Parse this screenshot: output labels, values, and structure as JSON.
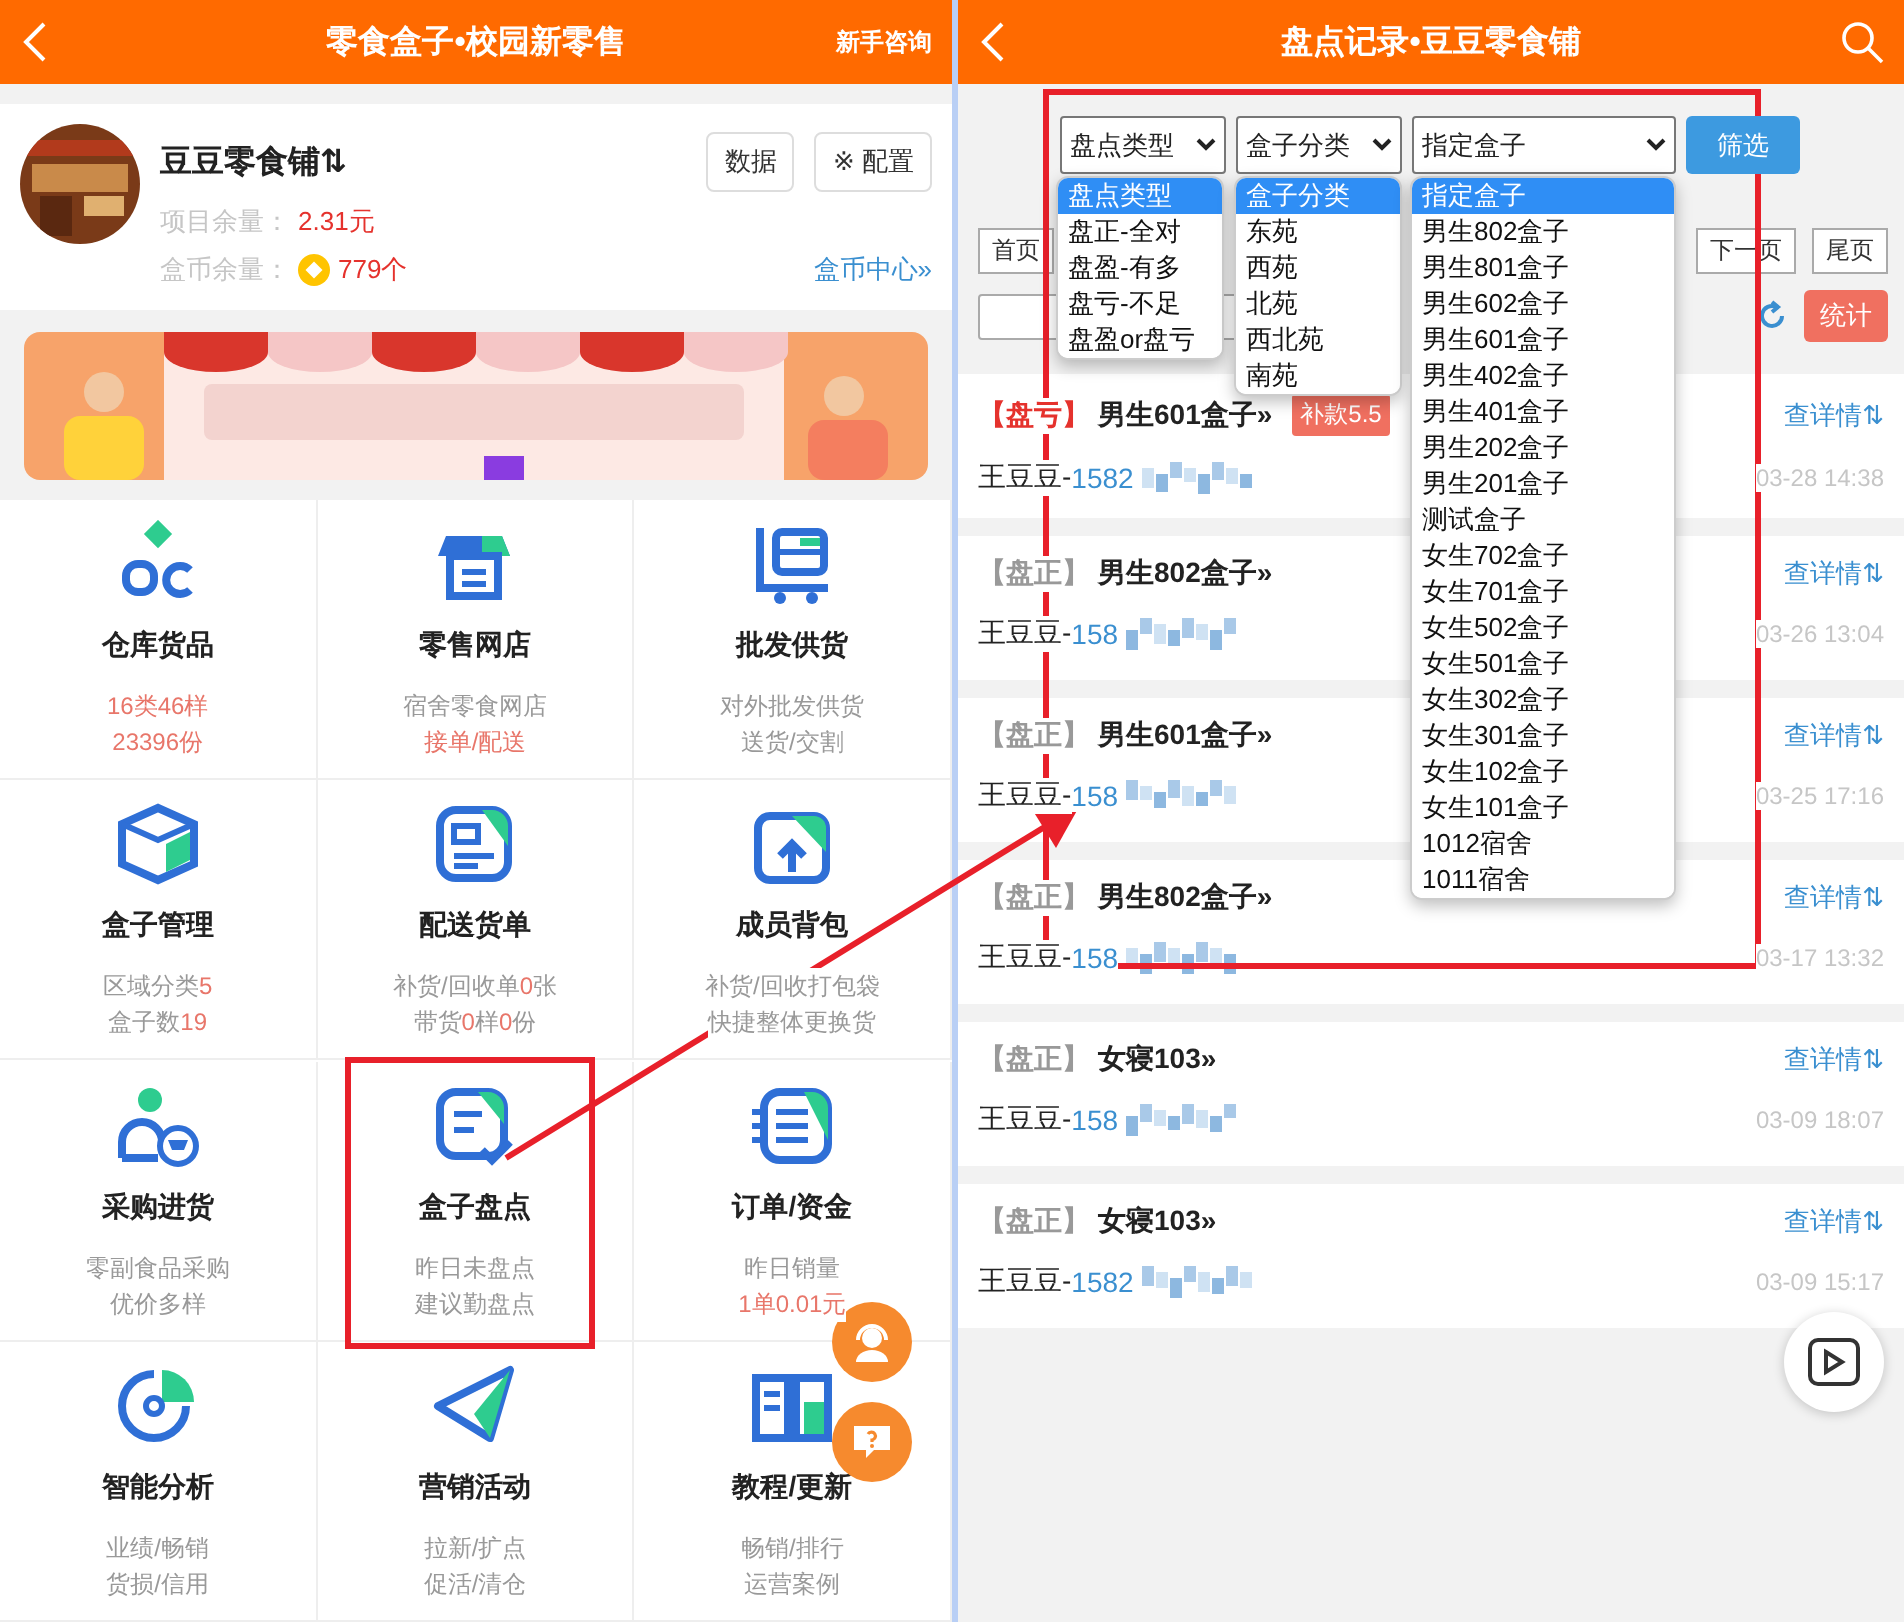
{
  "left": {
    "header": {
      "title": "零食盒子•校园新零售",
      "action": "新手咨询"
    },
    "store": {
      "name": "豆豆零食铺⇅",
      "buttons": [
        "数据",
        "※ 配置"
      ],
      "balance_label": "项目余量：",
      "balance_value": "2.31元",
      "coins_label": "盒币余量：",
      "coins_value": "779个",
      "link": "盒币中心»"
    },
    "tiles": [
      {
        "title": "仓库货品",
        "lines": [
          [
            {
              "text": "16类46样",
              "accent": true
            }
          ],
          [
            {
              "text": "23396份",
              "accent": true
            }
          ]
        ]
      },
      {
        "title": "零售网店",
        "lines": [
          [
            {
              "text": "宿舍零食网店",
              "accent": false
            }
          ],
          [
            {
              "text": "接单/配送",
              "accent": true
            }
          ]
        ]
      },
      {
        "title": "批发供货",
        "lines": [
          [
            {
              "text": "对外批发供货",
              "accent": false
            }
          ],
          [
            {
              "text": "送货/交割",
              "accent": false
            }
          ]
        ]
      },
      {
        "title": "盒子管理",
        "lines": [
          [
            {
              "text": "区域分类",
              "accent": false
            },
            {
              "text": "5",
              "accent": true
            }
          ],
          [
            {
              "text": "盒子数",
              "accent": false
            },
            {
              "text": "19",
              "accent": true
            }
          ]
        ]
      },
      {
        "title": "配送货单",
        "lines": [
          [
            {
              "text": "补货/回收单",
              "accent": false
            },
            {
              "text": "0",
              "accent": true
            },
            {
              "text": "张",
              "accent": false
            }
          ],
          [
            {
              "text": "带货",
              "accent": false
            },
            {
              "text": "0",
              "accent": true
            },
            {
              "text": "样",
              "accent": false
            },
            {
              "text": "0",
              "accent": true
            },
            {
              "text": "份",
              "accent": false
            }
          ]
        ]
      },
      {
        "title": "成员背包",
        "lines": [
          [
            {
              "text": "补货/回收打包袋",
              "accent": false
            }
          ],
          [
            {
              "text": "快捷整体更换货",
              "accent": false
            }
          ]
        ]
      },
      {
        "title": "采购进货",
        "lines": [
          [
            {
              "text": "零副食品采购",
              "accent": false
            }
          ],
          [
            {
              "text": "优价多样",
              "accent": false
            }
          ]
        ]
      },
      {
        "title": "盒子盘点",
        "lines": [
          [
            {
              "text": "昨日未盘点",
              "accent": false
            }
          ],
          [
            {
              "text": "建议勤盘点",
              "accent": false
            }
          ]
        ]
      },
      {
        "title": "订单/资金",
        "lines": [
          [
            {
              "text": "昨日销量",
              "accent": false
            }
          ],
          [
            {
              "text": "1单0.01元",
              "accent": true
            }
          ]
        ]
      },
      {
        "title": "智能分析",
        "lines": [
          [
            {
              "text": "业绩/畅销",
              "accent": false
            }
          ],
          [
            {
              "text": "货损/信用",
              "accent": false
            }
          ]
        ]
      },
      {
        "title": "营销活动",
        "lines": [
          [
            {
              "text": "拉新/扩点",
              "accent": false
            }
          ],
          [
            {
              "text": "促活/清仓",
              "accent": false
            }
          ]
        ]
      },
      {
        "title": "教程/更新",
        "lines": [
          [
            {
              "text": "畅销/排行",
              "accent": false
            }
          ],
          [
            {
              "text": "运营案例",
              "accent": false
            }
          ]
        ]
      }
    ]
  },
  "right": {
    "header": {
      "title": "盘点记录•豆豆零食铺"
    },
    "filters": [
      {
        "label": "盘点类型",
        "options": [
          {
            "label": "盘点类型",
            "selected": true
          },
          {
            "label": "盘正-全对",
            "selected": false
          },
          {
            "label": "盘盈-有多",
            "selected": false
          },
          {
            "label": "盘亏-不足",
            "selected": false
          },
          {
            "label": "盘盈or盘亏",
            "selected": false
          }
        ]
      },
      {
        "label": "盒子分类",
        "options": [
          {
            "label": "盒子分类",
            "selected": true
          },
          {
            "label": "东苑",
            "selected": false
          },
          {
            "label": "西苑",
            "selected": false
          },
          {
            "label": "北苑",
            "selected": false
          },
          {
            "label": "西北苑",
            "selected": false
          },
          {
            "label": "南苑",
            "selected": false
          }
        ]
      },
      {
        "label": "指定盒子",
        "options": [
          {
            "label": "指定盒子",
            "selected": true
          },
          {
            "label": "男生802盒子",
            "selected": false
          },
          {
            "label": "男生801盒子",
            "selected": false
          },
          {
            "label": "男生602盒子",
            "selected": false
          },
          {
            "label": "男生601盒子",
            "selected": false
          },
          {
            "label": "男生402盒子",
            "selected": false
          },
          {
            "label": "男生401盒子",
            "selected": false
          },
          {
            "label": "男生202盒子",
            "selected": false
          },
          {
            "label": "男生201盒子",
            "selected": false
          },
          {
            "label": "测试盒子",
            "selected": false
          },
          {
            "label": "女生702盒子",
            "selected": false
          },
          {
            "label": "女生701盒子",
            "selected": false
          },
          {
            "label": "女生502盒子",
            "selected": false
          },
          {
            "label": "女生501盒子",
            "selected": false
          },
          {
            "label": "女生302盒子",
            "selected": false
          },
          {
            "label": "女生301盒子",
            "selected": false
          },
          {
            "label": "女生102盒子",
            "selected": false
          },
          {
            "label": "女生101盒子",
            "selected": false
          },
          {
            "label": "1012宿舍",
            "selected": false
          },
          {
            "label": "1011宿舍",
            "selected": false
          }
        ]
      }
    ],
    "filter_button": "筛选",
    "pager": [
      "首页",
      "下一页",
      "尾页"
    ],
    "stats_button": "统计",
    "records": [
      {
        "tag": "【盘亏】",
        "color": "#e5322d",
        "box": "男生601盒子»",
        "badge": "补款5.5",
        "link": "查详情⇅",
        "person": "王豆豆-",
        "phone": "1582",
        "time": "03-28 14:38"
      },
      {
        "tag": "【盘正】",
        "color": "#999999",
        "box": "男生802盒子»",
        "link": "查详情⇅",
        "person": "王豆豆-",
        "phone": "158",
        "time": "03-26 13:04"
      },
      {
        "tag": "【盘正】",
        "color": "#999999",
        "box": "男生601盒子»",
        "link": "查详情⇅",
        "person": "王豆豆-",
        "phone": "158",
        "time": "03-25 17:16"
      },
      {
        "tag": "【盘正】",
        "color": "#999999",
        "box": "男生802盒子»",
        "link": "查详情⇅",
        "person": "王豆豆-",
        "phone": "158",
        "time": "03-17 13:32"
      },
      {
        "tag": "【盘正】",
        "color": "#999999",
        "box": "女寝103»",
        "link": "查详情⇅",
        "person": "王豆豆-",
        "phone": "158",
        "time": "03-09 18:07"
      },
      {
        "tag": "【盘正】",
        "color": "#999999",
        "box": "女寝103»",
        "link": "查详情⇅",
        "person": "王豆豆-",
        "phone": "1582",
        "time": "03-09 15:17"
      }
    ]
  }
}
